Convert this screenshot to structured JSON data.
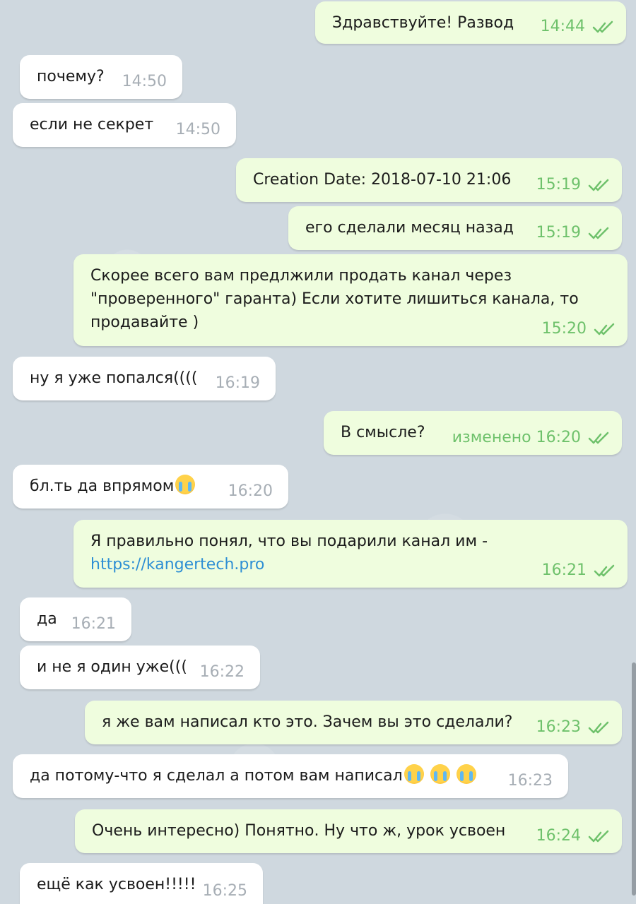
{
  "messages": [
    {
      "dir": "out",
      "text": "Здравствуйте! Развод",
      "time": "14:44"
    },
    {
      "dir": "in",
      "text": "почему?",
      "time": "14:50"
    },
    {
      "dir": "in",
      "text": "если не секрет",
      "time": "14:50"
    },
    {
      "dir": "out",
      "text": "Creation Date: 2018-07-10 21:06",
      "time": "15:19"
    },
    {
      "dir": "out",
      "text": "его сделали месяц назад",
      "time": "15:19"
    },
    {
      "dir": "out",
      "text": "Скорее всего вам предлжили продать канал через \"проверенного\" гаранта) Если хотите лишиться канала, то продавайте )",
      "time": "15:20"
    },
    {
      "dir": "in",
      "text": "ну я уже попался((((",
      "time": "16:19"
    },
    {
      "dir": "out",
      "text": "В смысле?",
      "time": "изменено 16:20"
    },
    {
      "dir": "in",
      "text": "бл.ть да впрямом",
      "emoji": "loudly-crying-face",
      "time": "16:20"
    },
    {
      "dir": "out",
      "text": "Я правильно понял, что вы подарили канал им -",
      "link": "https://kangertech.pro",
      "time": "16:21"
    },
    {
      "dir": "in",
      "text": "да",
      "time": "16:21"
    },
    {
      "dir": "in",
      "text": "и не я один уже(((",
      "time": "16:22"
    },
    {
      "dir": "out",
      "text": "я же вам написал кто это. Зачем вы это сделали?",
      "time": "16:23"
    },
    {
      "dir": "in",
      "text": "да потому-что я сделал а потом вам написал",
      "emoji": "loudly-crying-face x3",
      "time": "16:23"
    },
    {
      "dir": "out",
      "text": "Очень интересно) Понятно. Ну что ж, урок усвоен",
      "time": "16:24"
    },
    {
      "dir": "in",
      "text": "ещё как усвоен!!!!!",
      "time": "16:25"
    }
  ],
  "colors": {
    "incoming_bubble": "#ffffff",
    "outgoing_bubble": "#effdde",
    "outgoing_time": "#6ec16b",
    "incoming_time": "#a7aeb5",
    "link": "#2e8fd4"
  }
}
